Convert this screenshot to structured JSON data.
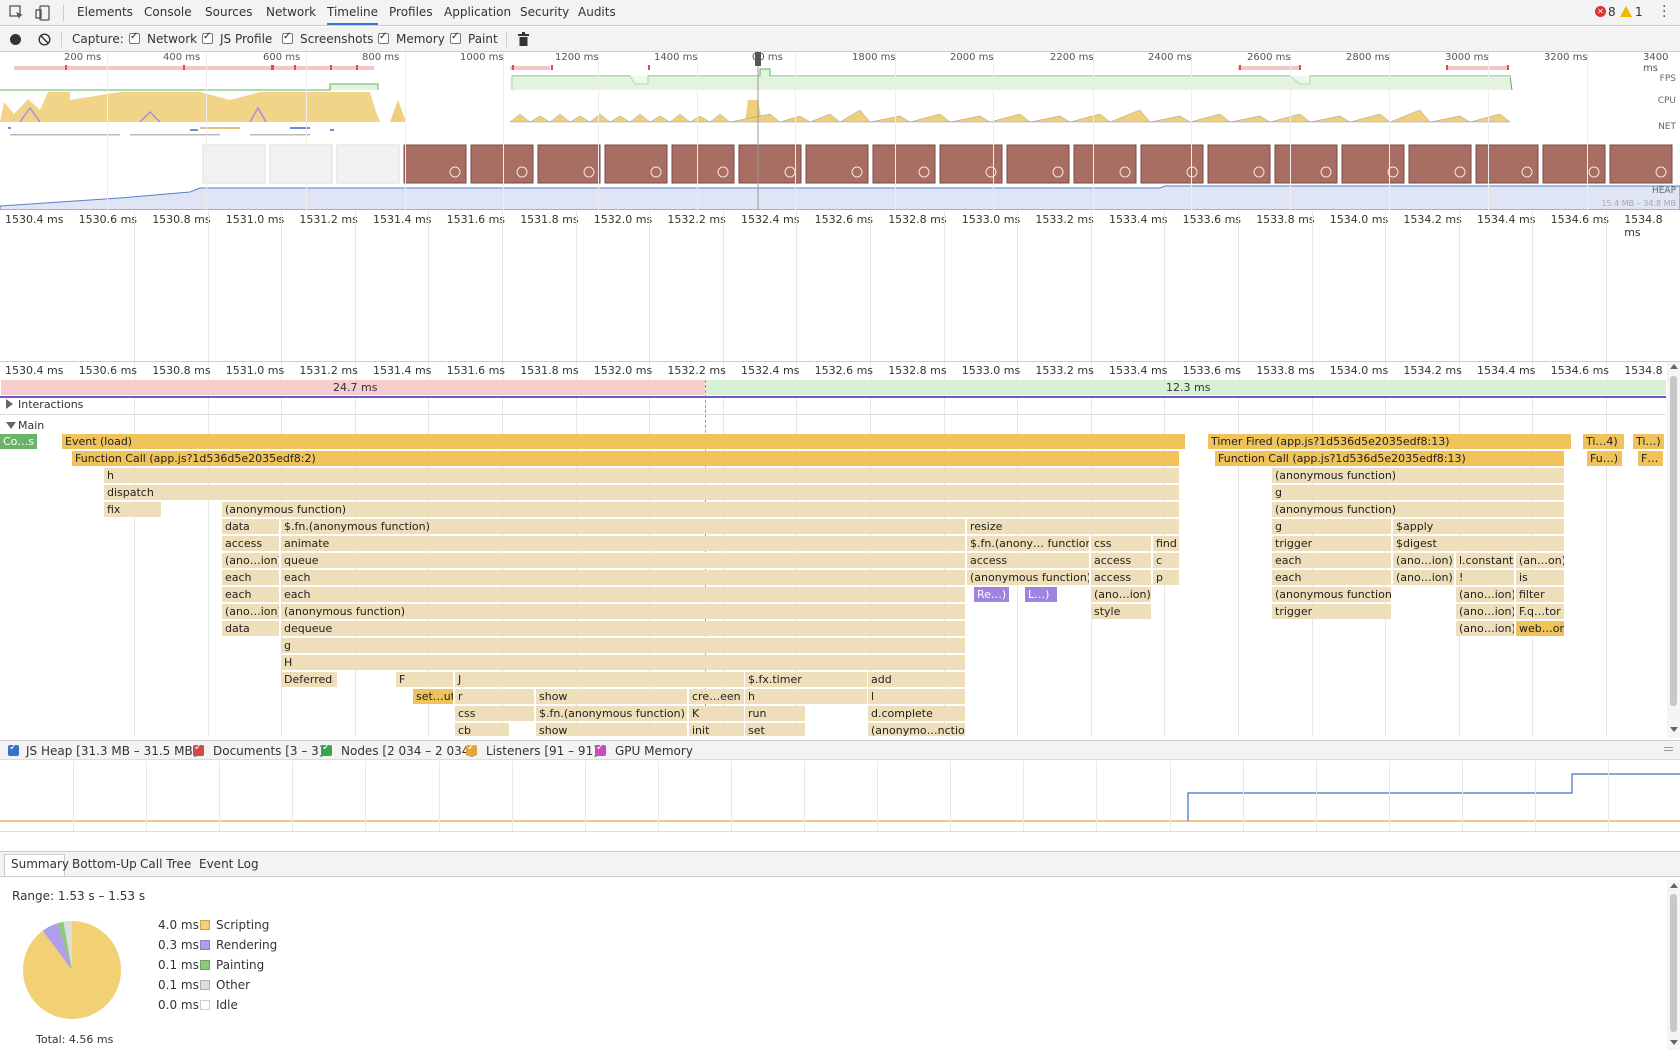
{
  "tabs": [
    "Elements",
    "Console",
    "Sources",
    "Network",
    "Timeline",
    "Profiles",
    "Application",
    "Security",
    "Audits"
  ],
  "active_tab": "Timeline",
  "badges": {
    "errors": "8",
    "warnings": "1"
  },
  "capture": {
    "label": "Capture:",
    "options": [
      "Network",
      "JS Profile",
      "Screenshots",
      "Memory",
      "Paint"
    ]
  },
  "overview": {
    "ticks": [
      "200 ms",
      "400 ms",
      "600 ms",
      "800 ms",
      "1000 ms",
      "1200 ms",
      "1400 ms",
      "00 ms",
      "1800 ms",
      "2000 ms",
      "2200 ms",
      "2400 ms",
      "2600 ms",
      "2800 ms",
      "3000 ms",
      "3200 ms",
      "3400 ms"
    ],
    "lanes": [
      "FPS",
      "CPU",
      "NET",
      "HEAP"
    ],
    "heap_range": "15.4 MB – 34.8 MB"
  },
  "detail_ticks": [
    "1530.4 ms",
    "1530.6 ms",
    "1530.8 ms",
    "1531.0 ms",
    "1531.2 ms",
    "1531.4 ms",
    "1531.6 ms",
    "1531.8 ms",
    "1532.0 ms",
    "1532.2 ms",
    "1532.4 ms",
    "1532.6 ms",
    "1532.8 ms",
    "1533.0 ms",
    "1533.2 ms",
    "1533.4 ms",
    "1533.6 ms",
    "1533.8 ms",
    "1534.0 ms",
    "1534.2 ms",
    "1534.4 ms",
    "1534.6 ms",
    "1534.8 ms"
  ],
  "detail_ticks_lower_last": "1534.8 n",
  "frames": {
    "first": "24.7 ms",
    "second": "12.3 ms"
  },
  "tracks": {
    "interactions": "Interactions",
    "main": "Main"
  },
  "flame": [
    [
      "Co…s",
      0,
      0,
      38,
      "g"
    ],
    [
      "Event (load)",
      0,
      62,
      1186,
      "Y"
    ],
    [
      "Timer Fired (app.js?1d536d5e2035edf8:13)",
      0,
      1208,
      1572,
      "Y"
    ],
    [
      "Ti…4)",
      0,
      1583,
      1625,
      "Y"
    ],
    [
      "Ti…)",
      0,
      1633,
      1665,
      "Y"
    ],
    [
      "Function Call (app.js?1d536d5e2035edf8:2)",
      1,
      72,
      1180,
      "Y"
    ],
    [
      "Function Call (app.js?1d536d5e2035edf8:13)",
      1,
      1215,
      1565,
      "Y"
    ],
    [
      "Fu…)",
      1,
      1587,
      1623,
      "Y"
    ],
    [
      "F…",
      1,
      1638,
      1664,
      "Y"
    ],
    [
      "h",
      2,
      104,
      1180,
      "y"
    ],
    [
      "(anonymous function)",
      2,
      1272,
      1565,
      "y"
    ],
    [
      "dispatch",
      3,
      104,
      1180,
      "y"
    ],
    [
      "g",
      3,
      1272,
      1565,
      "y"
    ],
    [
      "fix",
      4,
      104,
      162,
      "y"
    ],
    [
      "(anonymous function)",
      4,
      222,
      1180,
      "y"
    ],
    [
      "(anonymous function)",
      4,
      1272,
      1565,
      "y"
    ],
    [
      "data",
      5,
      222,
      280,
      "y"
    ],
    [
      "$.fn.(anonymous function)",
      5,
      281,
      966,
      "y"
    ],
    [
      "resize",
      5,
      967,
      1180,
      "y"
    ],
    [
      "g",
      5,
      1272,
      1392,
      "y"
    ],
    [
      "$apply",
      5,
      1393,
      1565,
      "y"
    ],
    [
      "access",
      6,
      222,
      280,
      "y"
    ],
    [
      "animate",
      6,
      281,
      966,
      "y"
    ],
    [
      "$.fn.(anony… function)",
      6,
      967,
      1090,
      "y"
    ],
    [
      "css",
      6,
      1091,
      1152,
      "y"
    ],
    [
      "find",
      6,
      1153,
      1180,
      "y"
    ],
    [
      "trigger",
      6,
      1272,
      1392,
      "y"
    ],
    [
      "$digest",
      6,
      1393,
      1565,
      "y"
    ],
    [
      "(ano…ion)",
      7,
      222,
      280,
      "y"
    ],
    [
      "queue",
      7,
      281,
      966,
      "y"
    ],
    [
      "access",
      7,
      967,
      1090,
      "y"
    ],
    [
      "access",
      7,
      1091,
      1152,
      "y"
    ],
    [
      "c",
      7,
      1153,
      1180,
      "y"
    ],
    [
      "each",
      7,
      1272,
      1392,
      "y"
    ],
    [
      "(ano…ion)",
      7,
      1393,
      1455,
      "y"
    ],
    [
      "l.constant",
      7,
      1456,
      1515,
      "y"
    ],
    [
      "(an…on)",
      7,
      1516,
      1565,
      "y"
    ],
    [
      "each",
      8,
      222,
      280,
      "y"
    ],
    [
      "each",
      8,
      281,
      966,
      "y"
    ],
    [
      "(anonymous function)",
      8,
      967,
      1090,
      "y"
    ],
    [
      "access",
      8,
      1091,
      1152,
      "y"
    ],
    [
      "p",
      8,
      1153,
      1180,
      "y"
    ],
    [
      "each",
      8,
      1272,
      1392,
      "y"
    ],
    [
      "(ano…ion)",
      8,
      1393,
      1455,
      "y"
    ],
    [
      "!",
      8,
      1456,
      1515,
      "y"
    ],
    [
      "is",
      8,
      1516,
      1565,
      "y"
    ],
    [
      "each",
      9,
      222,
      280,
      "y"
    ],
    [
      "each",
      9,
      281,
      966,
      "y"
    ],
    [
      "Re…)",
      9,
      974,
      1010,
      "p"
    ],
    [
      "L…)",
      9,
      1025,
      1058,
      "p"
    ],
    [
      "(ano…ion)",
      9,
      1091,
      1152,
      "y"
    ],
    [
      "(anonymous function)",
      9,
      1272,
      1392,
      "y"
    ],
    [
      "(ano…ion)",
      9,
      1456,
      1515,
      "y"
    ],
    [
      "filter",
      9,
      1516,
      1565,
      "y"
    ],
    [
      "(ano…ion)",
      10,
      222,
      280,
      "y"
    ],
    [
      "(anonymous function)",
      10,
      281,
      966,
      "y"
    ],
    [
      "style",
      10,
      1091,
      1152,
      "y"
    ],
    [
      "trigger",
      10,
      1272,
      1392,
      "y"
    ],
    [
      "(ano…ion)",
      10,
      1456,
      1515,
      "y"
    ],
    [
      "F.q…tor",
      10,
      1516,
      1565,
      "y"
    ],
    [
      "data",
      11,
      222,
      280,
      "y"
    ],
    [
      "dequeue",
      11,
      281,
      966,
      "y"
    ],
    [
      "(ano…ion)",
      11,
      1456,
      1515,
      "y"
    ],
    [
      "web…or",
      11,
      1516,
      1565,
      "Y"
    ],
    [
      "g",
      12,
      281,
      966,
      "y"
    ],
    [
      "H",
      13,
      281,
      966,
      "y"
    ],
    [
      "Deferred",
      14,
      281,
      338,
      "y"
    ],
    [
      "F",
      14,
      396,
      454,
      "y"
    ],
    [
      "J",
      14,
      455,
      745,
      "y"
    ],
    [
      "$.fx.timer",
      14,
      745,
      868,
      "y"
    ],
    [
      "add",
      14,
      868,
      966,
      "y"
    ],
    [
      "set…ut",
      15,
      413,
      454,
      "Y"
    ],
    [
      "r",
      15,
      455,
      535,
      "y"
    ],
    [
      "show",
      15,
      536,
      688,
      "y"
    ],
    [
      "cre…een",
      15,
      689,
      745,
      "y"
    ],
    [
      "h",
      15,
      745,
      868,
      "y"
    ],
    [
      "l",
      15,
      868,
      966,
      "y"
    ],
    [
      "css",
      16,
      455,
      535,
      "y"
    ],
    [
      "$.fn.(anonymous function)",
      16,
      536,
      688,
      "y"
    ],
    [
      "K",
      16,
      689,
      745,
      "y"
    ],
    [
      "run",
      16,
      745,
      806,
      "y"
    ],
    [
      "d.complete",
      16,
      868,
      966,
      "y"
    ],
    [
      "cb",
      17,
      455,
      510,
      "y"
    ],
    [
      "show",
      17,
      536,
      688,
      "y"
    ],
    [
      "init",
      17,
      689,
      745,
      "y"
    ],
    [
      "set",
      17,
      745,
      806,
      "y"
    ],
    [
      "(anonymo…nction)",
      17,
      868,
      966,
      "y"
    ]
  ],
  "counters": [
    {
      "label": "JS Heap [31.3 MB – 31.5 MB]",
      "color": "#3b72c9"
    },
    {
      "label": "Documents [3 – 3]",
      "color": "#d14848"
    },
    {
      "label": "Nodes [2 034 – 2 034]",
      "color": "#3aa549"
    },
    {
      "label": "Listeners [91 – 91]",
      "color": "#e6a33b"
    },
    {
      "label": "GPU Memory",
      "color": "#c84bc4"
    }
  ],
  "bottom_tabs": [
    "Summary",
    "Bottom-Up",
    "Call Tree",
    "Event Log"
  ],
  "summary": {
    "range": "Range: 1.53 s – 1.53 s",
    "total": "Total: 4.56 ms",
    "rows": [
      {
        "value": "4.0 ms",
        "label": "Scripting",
        "color": "#f2d074"
      },
      {
        "value": "0.3 ms",
        "label": "Rendering",
        "color": "#af9ee9"
      },
      {
        "value": "0.1 ms",
        "label": "Painting",
        "color": "#8dc97e"
      },
      {
        "value": "0.1 ms",
        "label": "Other",
        "color": "#dddddd"
      },
      {
        "value": "0.0 ms",
        "label": "Idle",
        "color": "#ffffff"
      }
    ]
  }
}
